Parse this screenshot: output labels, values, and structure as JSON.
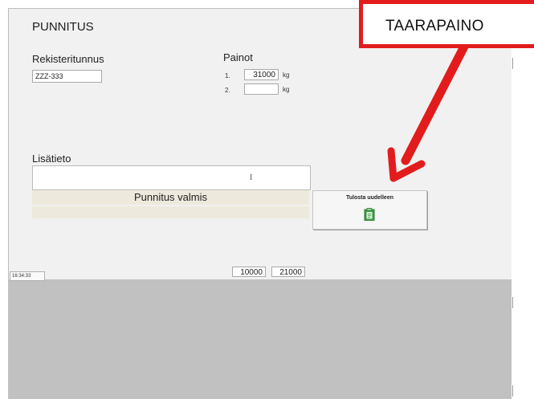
{
  "form": {
    "title": "PUNNITUS",
    "registration_label": "Rekisteritunnus",
    "registration_value": "ZZZ-333",
    "weights_label": "Painot",
    "weights": [
      {
        "row": "1.",
        "value": "31000",
        "unit": "kg"
      },
      {
        "row": "2.",
        "value": "",
        "unit": "kg"
      }
    ],
    "info_label": "Lisätieto",
    "info_value": "",
    "status_text": "Punnitus valmis",
    "print_button_label": "Tulosta uudelleen",
    "print_icon": "clipboard-icon"
  },
  "footer": {
    "time": "16:34:33",
    "totals": [
      "10000",
      "21000"
    ]
  },
  "annotation": {
    "label": "TAARAPAINO",
    "color": "#e21c1c"
  }
}
